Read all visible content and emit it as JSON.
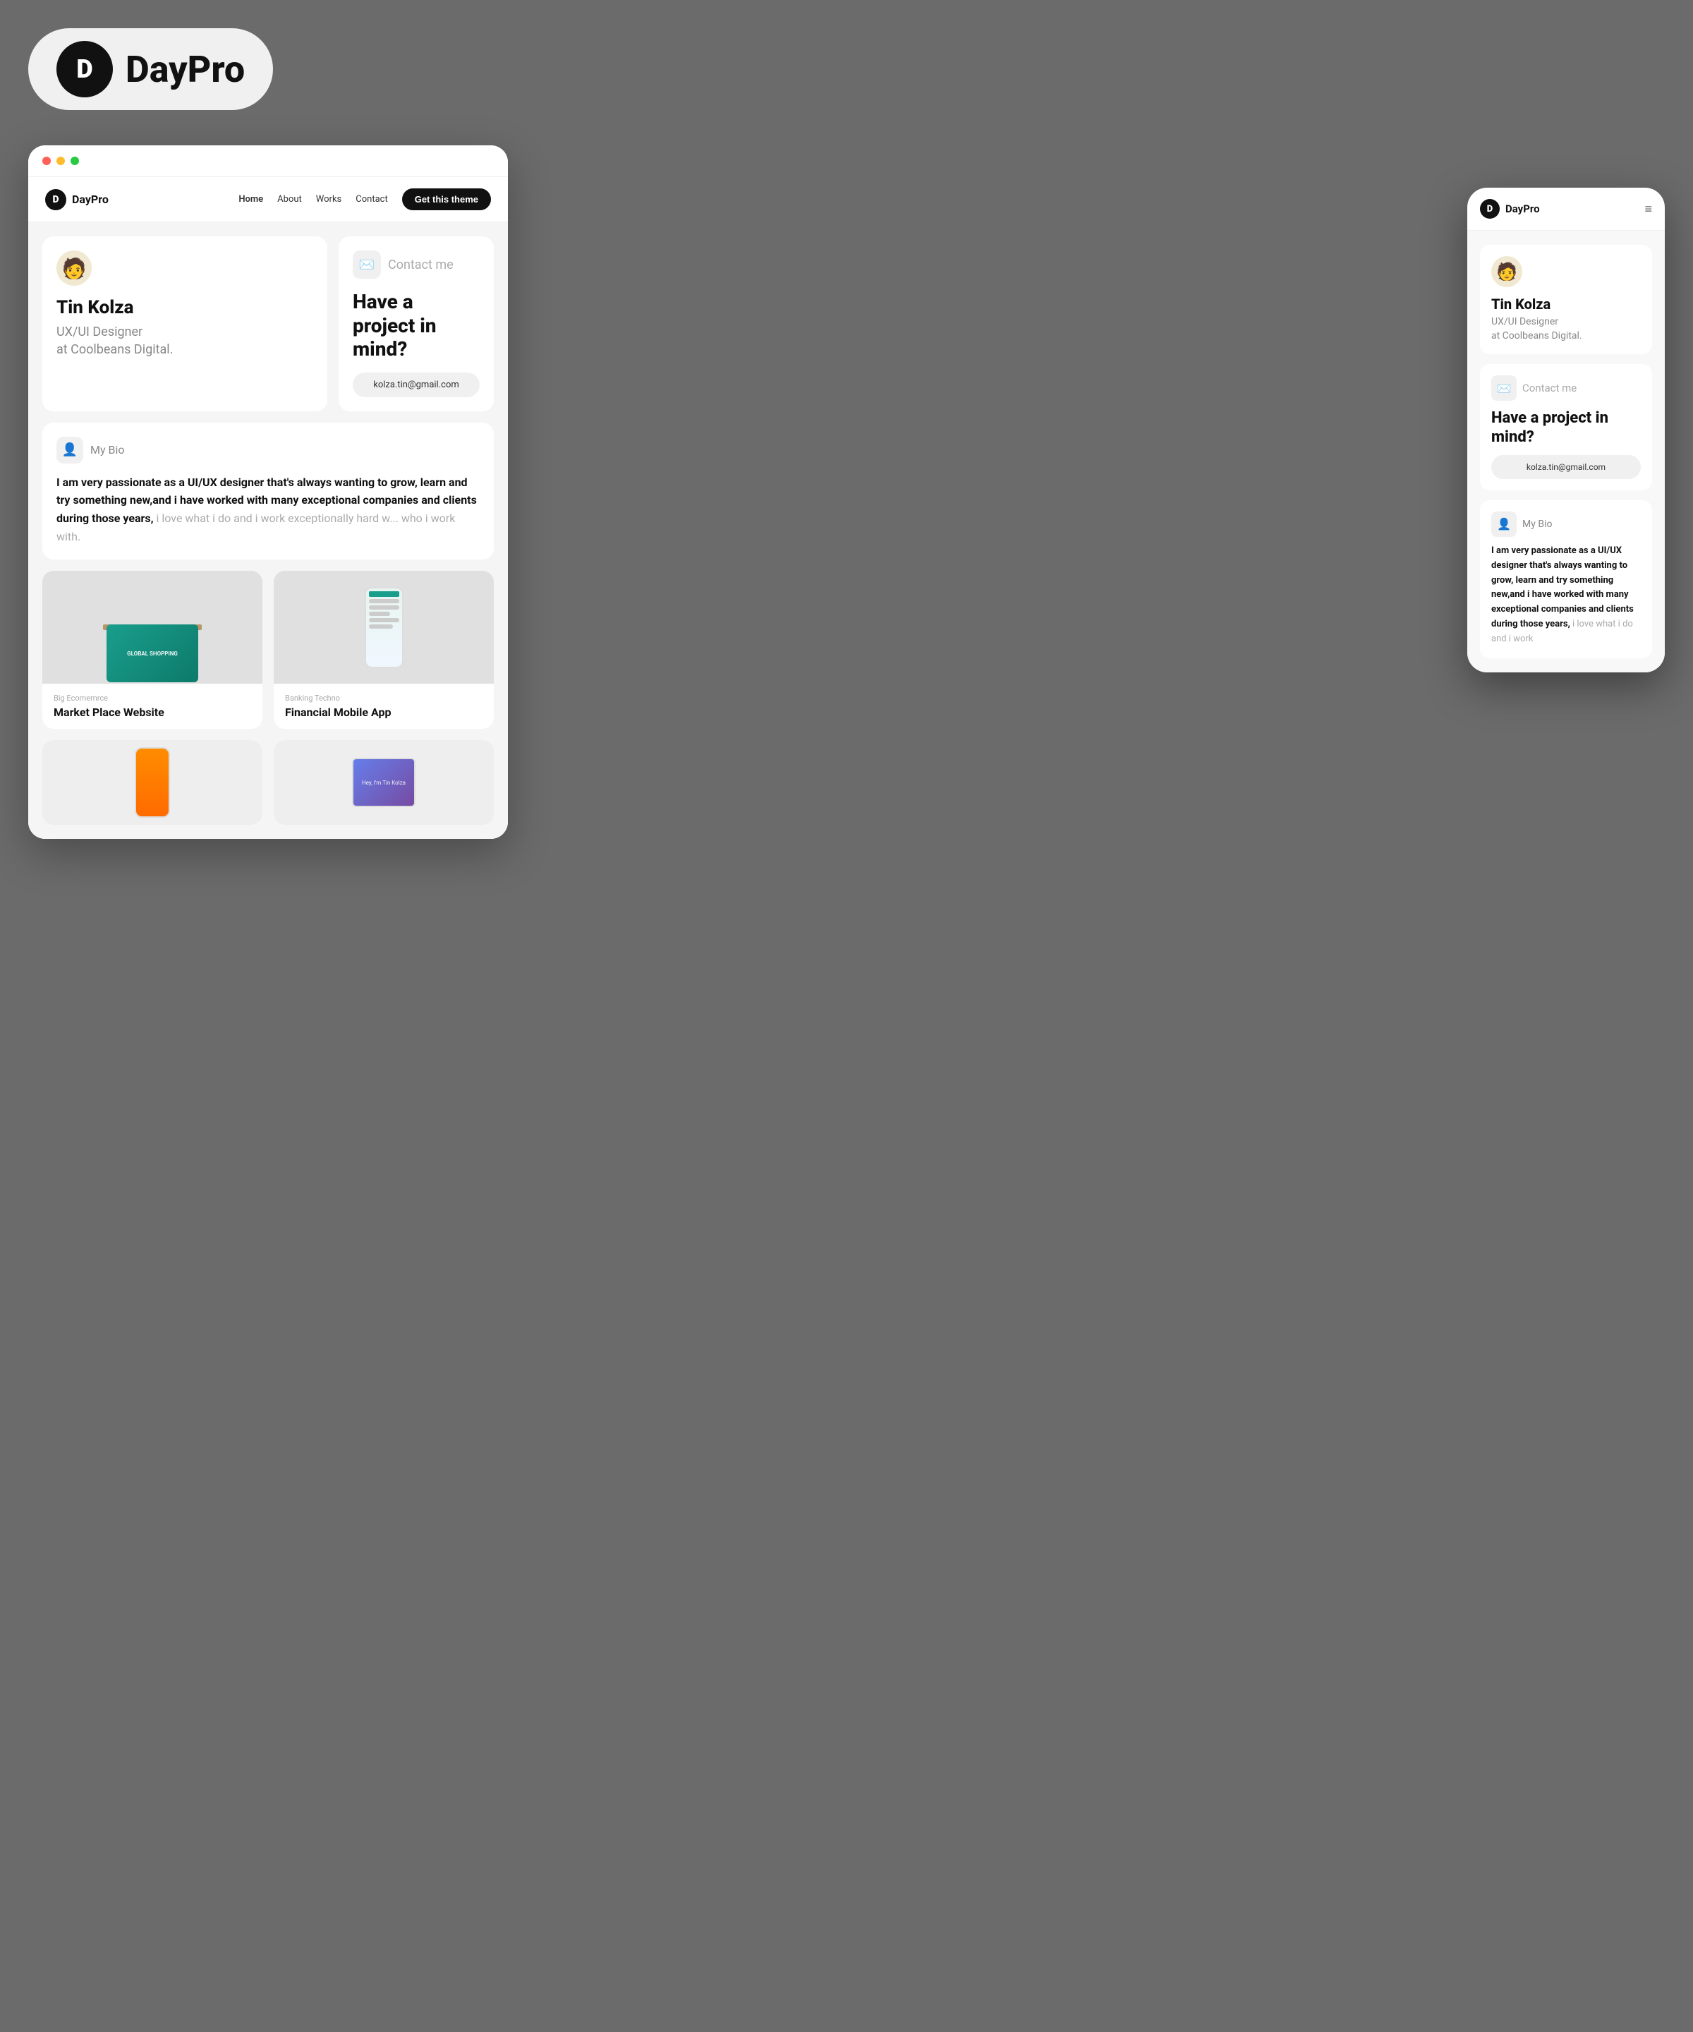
{
  "topLogo": {
    "letter": "D",
    "name": "DayPro"
  },
  "desktopWindow": {
    "nav": {
      "logoLetter": "D",
      "logoName": "DayPro",
      "links": [
        {
          "label": "Home",
          "active": true
        },
        {
          "label": "About",
          "active": false
        },
        {
          "label": "Works",
          "active": false
        },
        {
          "label": "Contact",
          "active": false
        }
      ],
      "ctaLabel": "Get this theme"
    },
    "heroCard": {
      "avatar": "🧑",
      "name": "Tin Kolza",
      "titleLine1": "UX/UI Designer",
      "titleLine2": "at Coolbeans Digital."
    },
    "contactCard": {
      "iconEmoji": "✉️",
      "label": "Contact me",
      "heading": "Have a project in mind?",
      "email": "kolza.tin@gmail.com"
    },
    "bioCard": {
      "iconEmoji": "👤",
      "label": "My Bio",
      "textBold": "I am very passionate as a UI/UX designer that's always wanting to grow, learn and try something new,and i have worked with many exceptional companies and clients during those years,",
      "textLight": " i love what i do and i work exceptionally hard w... who i work with."
    },
    "portfolio": [
      {
        "category": "Big Ecomemrce",
        "title": "Market Place Website",
        "type": "laptop"
      },
      {
        "category": "Banking Techno",
        "title": "Financial Mobile App",
        "type": "phone"
      }
    ],
    "portfolio2": [
      {
        "type": "phone2"
      },
      {
        "type": "tablet"
      }
    ]
  },
  "mobileWindow": {
    "nav": {
      "logoLetter": "D",
      "logoName": "DayPro",
      "menuIcon": "≡"
    },
    "heroCard": {
      "avatar": "🧑",
      "name": "Tin Kolza",
      "titleLine1": "UX/UI Designer",
      "titleLine2": "at Coolbeans Digital."
    },
    "contactCard": {
      "iconEmoji": "✉️",
      "label": "Contact me",
      "heading": "Have a project in mind?",
      "email": "kolza.tin@gmail.com"
    },
    "bioCard": {
      "iconEmoji": "👤",
      "label": "My Bio",
      "textBold": "I am very passionate as a UI/UX designer that's always wanting to grow, learn and try something new,and i have worked with many exceptional companies and clients during those years,",
      "textLight": " i love what i do and i work"
    }
  }
}
